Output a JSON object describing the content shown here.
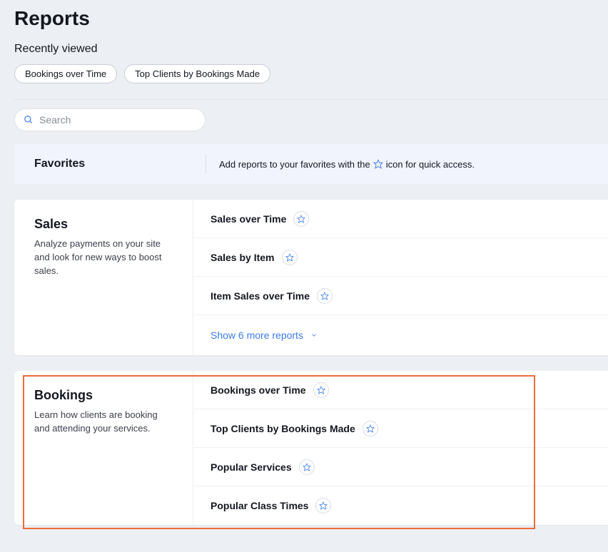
{
  "page": {
    "title": "Reports",
    "recentlyViewedLabel": "Recently viewed"
  },
  "recentChips": [
    {
      "label": "Bookings over Time"
    },
    {
      "label": "Top Clients by Bookings Made"
    }
  ],
  "search": {
    "placeholder": "Search",
    "value": ""
  },
  "favorites": {
    "title": "Favorites",
    "hintPrefix": "Add reports to your favorites with the",
    "hintSuffix": "icon for quick access."
  },
  "sections": {
    "sales": {
      "title": "Sales",
      "description": "Analyze payments on your site and look for new ways to boost sales.",
      "rows": [
        {
          "label": "Sales over Time"
        },
        {
          "label": "Sales by Item"
        },
        {
          "label": "Item Sales over Time"
        }
      ],
      "showMore": "Show 6 more reports"
    },
    "bookings": {
      "title": "Bookings",
      "description": "Learn how clients are booking and attending your services.",
      "rows": [
        {
          "label": "Bookings over Time"
        },
        {
          "label": "Top Clients by Bookings Made"
        },
        {
          "label": "Popular Services"
        },
        {
          "label": "Popular Class Times"
        }
      ]
    }
  }
}
